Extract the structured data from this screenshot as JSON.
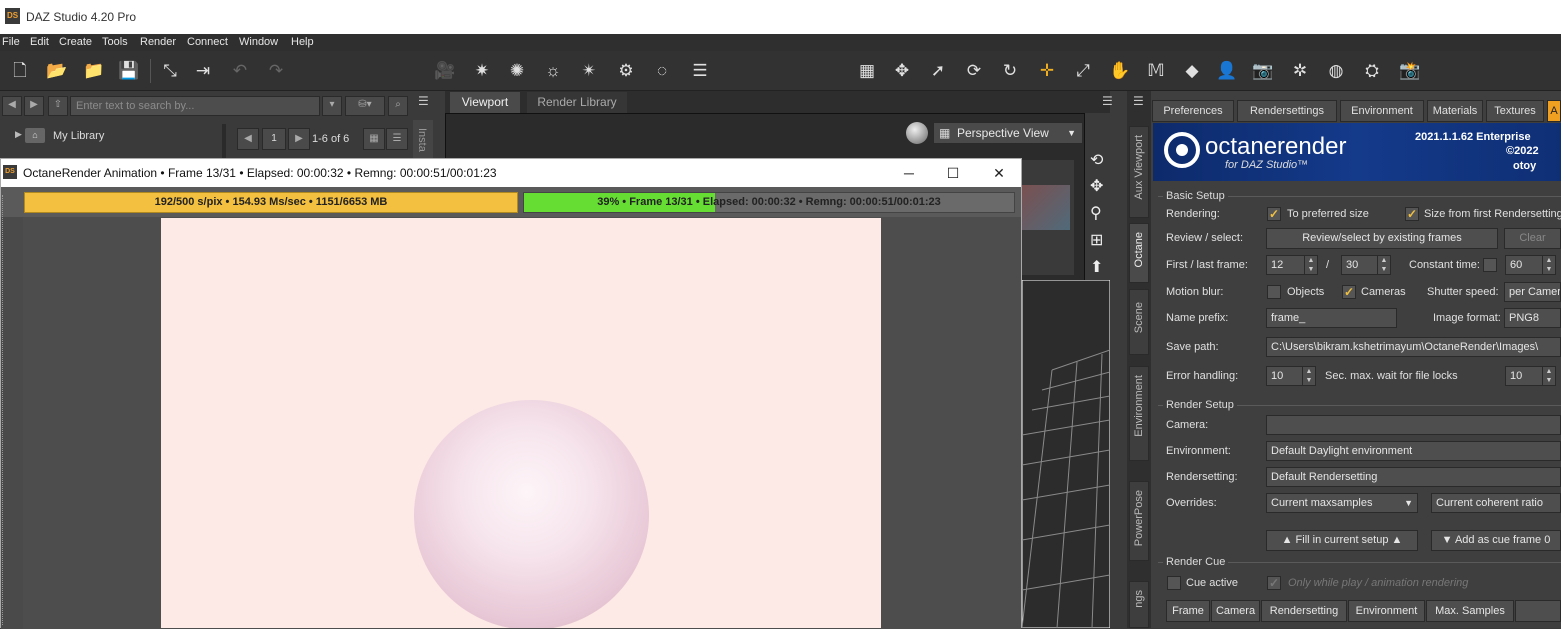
{
  "app": {
    "title": "DAZ Studio 4.20 Pro",
    "logo": "DS"
  },
  "menu": [
    "File",
    "Edit",
    "Create",
    "Tools",
    "Render",
    "Connect",
    "Window",
    "Help"
  ],
  "library": {
    "search_placeholder": "Enter text to search by...",
    "item": "My Library",
    "page": "1",
    "range": "1-6 of 6",
    "side_tab": "Insta"
  },
  "viewport": {
    "tabs": [
      "Viewport",
      "Render Library"
    ],
    "view": "Perspective View"
  },
  "octane_window": {
    "title": "OctaneRender Animation • Frame 13/31 • Elapsed: 00:00:32 • Remng: 00:00:51/00:01:23",
    "stats": "192/500 s/pix • 154.93 Ms/sec • 1151/6653 MB",
    "progress_text": "39% • Frame 13/31 • Elapsed: 00:00:32 • Remng: 00:00:51/00:01:23",
    "progress": 0.39,
    "colors": {
      "stats_bar": "#f3c040",
      "progress": "#66dd33",
      "render_bg": "#fde9e5"
    }
  },
  "dock_tabs": [
    "Aux Viewport",
    "Octane",
    "Scene",
    "Environment",
    "PowerPose",
    "ngs"
  ],
  "octane_panel": {
    "tabs": [
      "Preferences",
      "Rendersettings",
      "Environment",
      "Materials",
      "Textures",
      "A"
    ],
    "banner": {
      "brand": "octanerender",
      "sub": "for DAZ Studio™",
      "version": "2021.1.1.62 Enterprise",
      "year": "©2022",
      "company": "otoy"
    },
    "basic_setup": {
      "title": "Basic Setup",
      "rendering_label": "Rendering:",
      "to_preferred_size": "To preferred size",
      "size_from_first": "Size from first Rendersetting",
      "review_label": "Review / select:",
      "review_button": "Review/select by existing frames",
      "clear_button": "Clear",
      "frames_label": "First / last frame:",
      "first_frame": "12",
      "slash": "/",
      "last_frame": "30",
      "constant_time_label": "Constant time:",
      "constant_time": "60",
      "motion_blur_label": "Motion blur:",
      "objects": "Objects",
      "cameras": "Cameras",
      "shutter_speed_label": "Shutter speed:",
      "shutter_speed": "per Camera",
      "name_prefix_label": "Name prefix:",
      "name_prefix": "frame_",
      "image_format_label": "Image format:",
      "image_format": "PNG8",
      "save_path_label": "Save path:",
      "save_path": "C:\\Users\\bikram.kshetrimayum\\OctaneRender\\Images\\",
      "error_handling_label": "Error handling:",
      "error_handling": "10",
      "wait_label": "Sec. max. wait for file locks",
      "wait_value": "10"
    },
    "render_setup": {
      "title": "Render Setup",
      "camera_label": "Camera:",
      "camera": "",
      "environment_label": "Environment:",
      "environment": "Default Daylight environment",
      "rendersetting_label": "Rendersetting:",
      "rendersetting": "Default Rendersetting",
      "overrides_label": "Overrides:",
      "override1": "Current maxsamples",
      "override2": "Current coherent ratio",
      "fill_button": "▲ Fill in current setup ▲",
      "cue_button": "▼ Add as cue frame 0"
    },
    "render_cue": {
      "title": "Render Cue",
      "cue_active": "Cue active",
      "only_while": "Only while play / animation rendering",
      "columns": [
        "Frame",
        "Camera",
        "Rendersetting",
        "Environment",
        "Max. Samples"
      ]
    }
  }
}
